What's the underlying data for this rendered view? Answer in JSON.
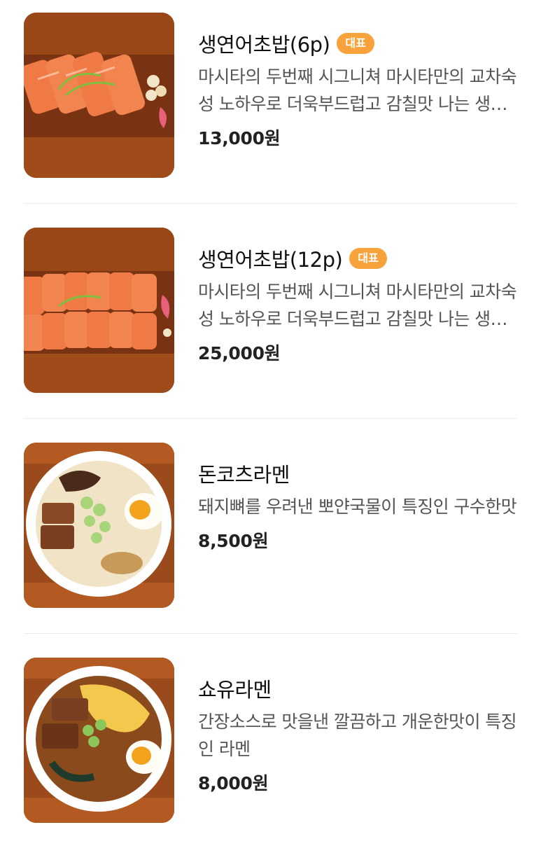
{
  "menu": {
    "items": [
      {
        "name": "생연어초밥(6p)",
        "badge": "대표",
        "description": "마시타의 두번째 시그니쳐 마시타만의 교차숙성 노하우로 더욱부드럽고 감칠맛 나는 생연어초밥",
        "price": "13,000원",
        "image": "salmon-sushi-6p-photo"
      },
      {
        "name": "생연어초밥(12p)",
        "badge": "대표",
        "description": "마시타의 두번째 시그니쳐 마시타만의 교차숙성 노하우로 더욱부드럽고 감칠맛 나는 생연어초밥",
        "price": "25,000원",
        "image": "salmon-sushi-12p-photo"
      },
      {
        "name": "돈코츠라멘",
        "description": "돼지뼈를 우려낸 뽀얀국물이 특징인 구수한맛",
        "price": "8,500원",
        "image": "tonkotsu-ramen-photo"
      },
      {
        "name": "쇼유라멘",
        "description": "간장소스로 맛을낸 깔끔하고 개운한맛이 특징인 라멘",
        "price": "8,000원",
        "image": "shoyu-ramen-photo"
      }
    ]
  },
  "colors": {
    "badge": "#f7a23b",
    "wood": "#8a3c14",
    "salmon": "#f07a45",
    "tonkotsu_broth": "#f1e4c6",
    "shoyu_broth": "#8a4a1c"
  }
}
